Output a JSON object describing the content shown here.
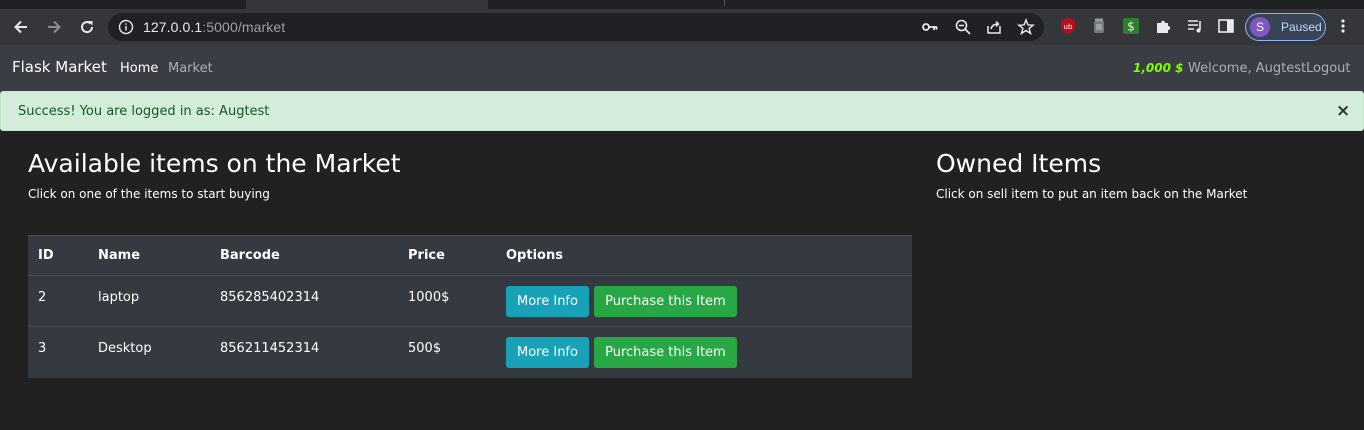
{
  "browser": {
    "url_host": "127.0.0.1",
    "url_path": ":5000/market",
    "profile_initial": "S",
    "profile_status": "Paused",
    "ext_adblock_label": "ub",
    "ext_money_label": "$"
  },
  "navbar": {
    "brand": "Flask Market",
    "links": [
      "Home",
      "Market"
    ],
    "budget": "1,000 $",
    "welcome": "Welcome, Augtest",
    "logout": "Logout"
  },
  "alert": {
    "message": "Success! You are logged in as: Augtest",
    "close": "×"
  },
  "market": {
    "title": "Available items on the Market",
    "subtitle": "Click on one of the items to start buying",
    "columns": [
      "ID",
      "Name",
      "Barcode",
      "Price",
      "Options"
    ],
    "rows": [
      {
        "id": "2",
        "name": "laptop",
        "barcode": "856285402314",
        "price": "1000$",
        "info_label": "More Info",
        "buy_label": "Purchase this Item"
      },
      {
        "id": "3",
        "name": "Desktop",
        "barcode": "856211452314",
        "price": "500$",
        "info_label": "More Info",
        "buy_label": "Purchase this Item"
      }
    ]
  },
  "owned": {
    "title": "Owned Items",
    "subtitle": "Click on sell item to put an item back on the Market"
  },
  "colors": {
    "navbar_bg": "#3a3d44",
    "budget": "#7fff00",
    "btn_info": "#17a2b8",
    "btn_success": "#28a745",
    "alert_bg": "#d4edda"
  }
}
